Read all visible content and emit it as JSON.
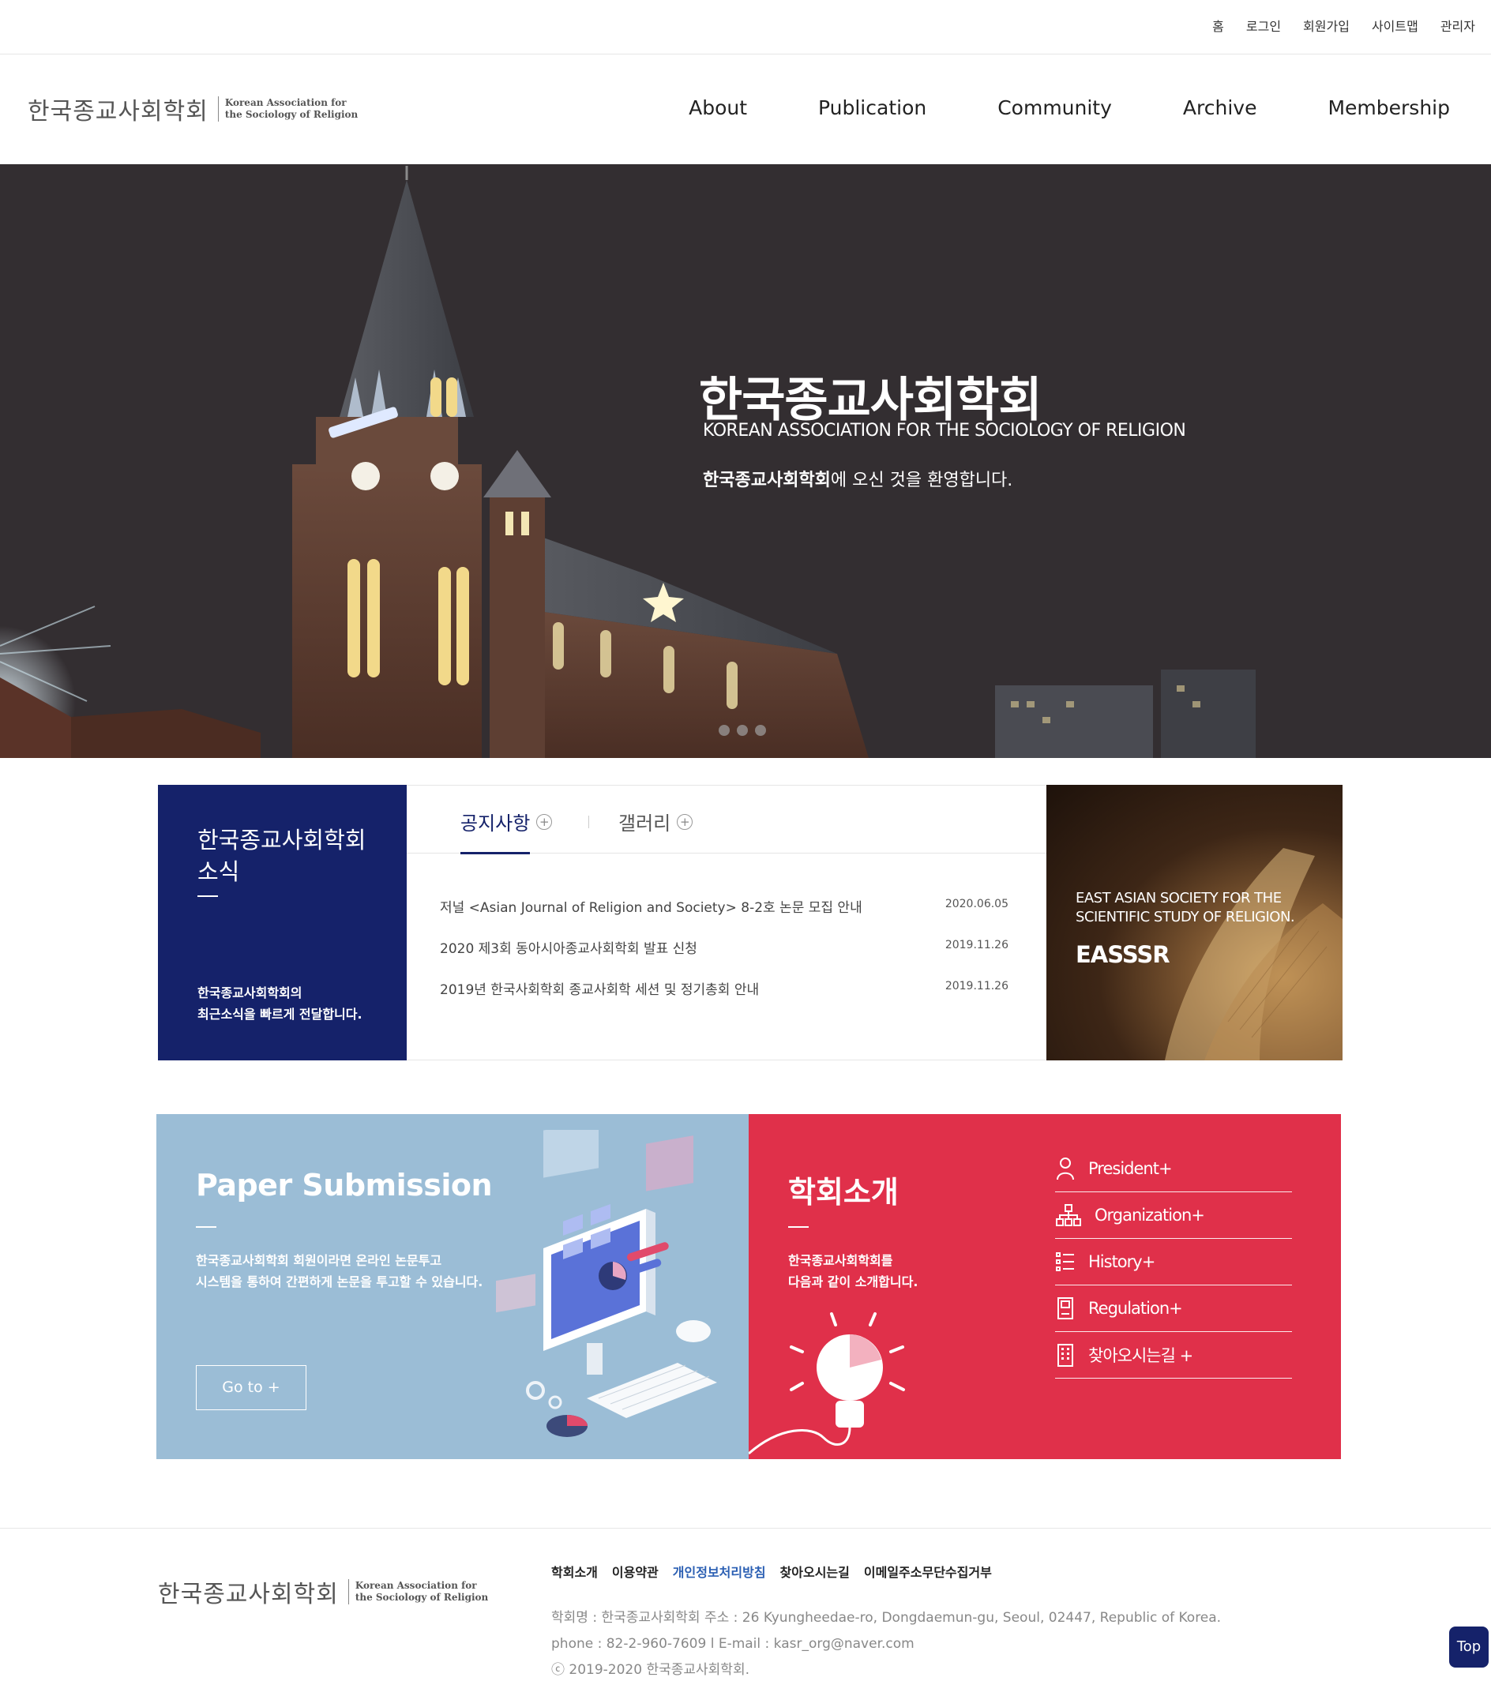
{
  "utility_nav": [
    "홈",
    "로그인",
    "회원가입",
    "사이트맵",
    "관리자"
  ],
  "logo": {
    "ko": "한국종교사회학회",
    "en_line1": "Korean Association for",
    "en_line2": "the Sociology of Religion"
  },
  "main_nav": [
    "About",
    "Publication",
    "Community",
    "Archive",
    "Membership"
  ],
  "hero": {
    "title": "한국종교사회학회",
    "subtitle": "KOREAN ASSOCIATION FOR THE SOCIOLOGY OF RELIGION",
    "welcome_bold": "한국종교사회학회",
    "welcome_rest": "에 오신 것을 환영합니다."
  },
  "news": {
    "box_title": "한국종교사회학회 소식",
    "box_desc_line1": "한국종교사회학회의",
    "box_desc_line2": "최근소식을 빠르게 전달합니다.",
    "tabs": [
      "공지사항",
      "갤러리"
    ],
    "plus_glyph": "+",
    "items": [
      {
        "title": "저널 <Asian Journal of Religion and Society> 8-2호 논문 모집 안내",
        "date": "2020.06.05"
      },
      {
        "title": "2020 제3회 동아시아종교사회학회 발표 신청",
        "date": "2019.11.26"
      },
      {
        "title": "2019년 한국사회학회 종교사회학 세션 및 정기총회 안내",
        "date": "2019.11.26"
      }
    ]
  },
  "eassr": {
    "line1": "EAST ASIAN SOCIETY FOR THE",
    "line2": "SCIENTIFIC STUDY OF RELIGION.",
    "abbr": "EASSSR"
  },
  "paper": {
    "title": "Paper Submission",
    "desc_line1": "한국종교사회학회 회원이라면 온라인 논문투고",
    "desc_line2": "시스템을 통하여 간편하게 논문을 투고할 수 있습니다.",
    "button": "Go to +"
  },
  "intro": {
    "title": "학회소개",
    "desc_line1": "한국종교사회학회를",
    "desc_line2": "다음과 같이 소개합니다.",
    "links": [
      {
        "label": "President+",
        "icon": "person-icon"
      },
      {
        "label": "Organization+",
        "icon": "org-chart-icon"
      },
      {
        "label": "History+",
        "icon": "list-icon"
      },
      {
        "label": "Regulation+",
        "icon": "book-icon"
      },
      {
        "label": "찾아오시는길 +",
        "icon": "building-icon"
      }
    ]
  },
  "footer": {
    "nav": [
      "학회소개",
      "이용약관",
      "개인정보처리방침",
      "찾아오시는길",
      "이메일주소무단수집거부"
    ],
    "address": "학회명 : 한국종교사회학회 주소 : 26 Kyungheedae-ro, Dongdaemun-gu, Seoul, 02447, Republic of Korea.",
    "contact": "phone : 82-2-960-7609 l E-mail : kasr_org@naver.com",
    "copyright": "ⓒ 2019-2020 한국종교사회학회."
  },
  "top_button": "Top",
  "colors": {
    "navy": "#15226a",
    "red": "#e0304a",
    "light_blue": "#9bbdd6",
    "link_blue": "#2b5fb3"
  }
}
